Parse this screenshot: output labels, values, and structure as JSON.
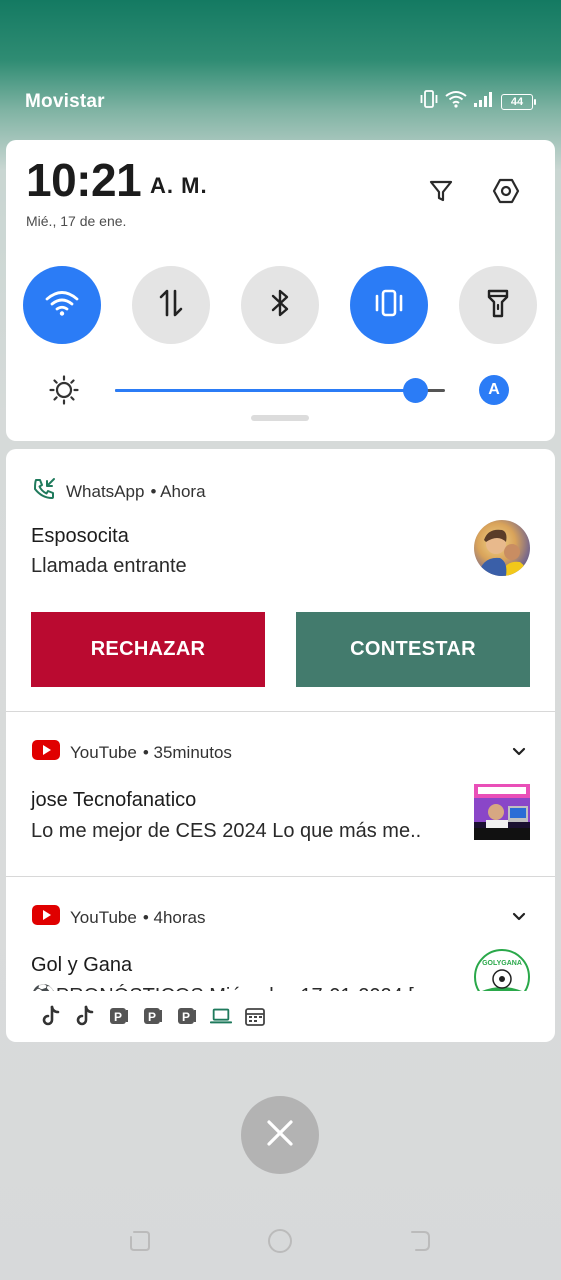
{
  "status_bar": {
    "carrier": "Movistar",
    "battery": "44",
    "icons": [
      "vibrate-icon",
      "wifi-icon",
      "signal-icon",
      "battery-icon"
    ]
  },
  "quick_settings": {
    "time": "10:21",
    "ampm": "A. M.",
    "date": "Mié., 17 de ene.",
    "top_icons": [
      "filter-icon",
      "settings-icon"
    ],
    "tiles": [
      {
        "name": "wifi",
        "icon": "wifi-icon",
        "on": true
      },
      {
        "name": "mobile-data",
        "icon": "data-arrows-icon",
        "on": false
      },
      {
        "name": "bluetooth",
        "icon": "bluetooth-icon",
        "on": false
      },
      {
        "name": "vibrate",
        "icon": "vibrate-icon",
        "on": true
      },
      {
        "name": "flashlight",
        "icon": "flashlight-icon",
        "on": false
      }
    ],
    "brightness_level": 0.91,
    "auto_brightness_label": "A",
    "accent_color": "#2b7cf6"
  },
  "notifications": {
    "whatsapp": {
      "app": "WhatsApp",
      "time": "• Ahora",
      "title": "Esposocita",
      "text": "Llamada entrante",
      "reject_label": "RECHAZAR",
      "accept_label": "CONTESTAR",
      "reject_color": "#ba0a30",
      "accept_color": "#437b6d"
    },
    "youtube_1": {
      "app": "YouTube",
      "time": "• 35minutos",
      "title": "jose Tecnofanatico",
      "text": "Lo me mejor de CES 2024 Lo que más me.."
    },
    "youtube_2": {
      "app": "YouTube",
      "time": "• 4horas",
      "title": "Gol y Gana",
      "text": "⚽PRONÓSTICOS Miércoles 17-01-2024 [",
      "thumb_label": "GOLYGANA"
    }
  },
  "overflow_icons": [
    "tiktok-icon",
    "tiktok-icon",
    "p-app-icon",
    "p-app-icon",
    "p-app-icon",
    "laptop-icon",
    "calendar-icon"
  ],
  "nav_bar": [
    "recents-icon",
    "home-icon",
    "back-icon"
  ]
}
